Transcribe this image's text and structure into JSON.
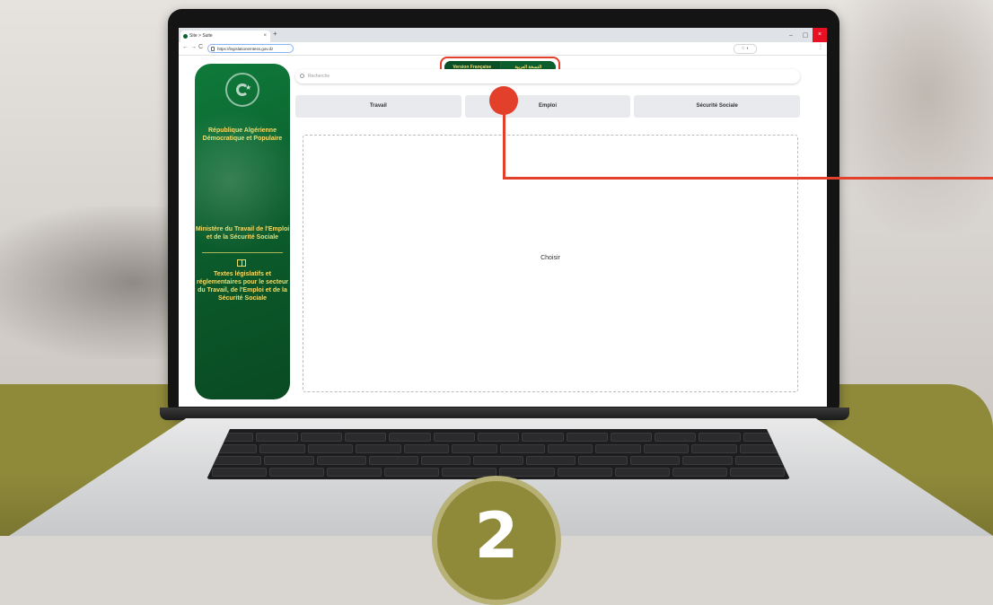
{
  "browser": {
    "tab_title": "Site > Suite",
    "tab_close": "×",
    "new_tab": "+",
    "url": "https://legislationemtess.gov.dz",
    "window_controls": [
      "–",
      "▢",
      "×"
    ],
    "nav": [
      "←",
      "→",
      "C"
    ]
  },
  "page": {
    "language": {
      "french": "Version Française",
      "arabic": "النسخة العربية"
    },
    "search_placeholder": "Recherche",
    "tabs": [
      "Travail",
      "Emploi",
      "Sécurité Sociale"
    ],
    "content_placeholder": "Choisir",
    "sidebar": {
      "country": "République Algérienne Démocratique et Populaire",
      "ministry": "Ministère du Travail de l'Emploi et de la Sécurité Sociale",
      "texts": "Textes législatifs et réglementaires pour le secteur du Travail, de l'Emploi et de la Sécurité Sociale"
    }
  },
  "step": {
    "number": "2"
  },
  "colors": {
    "brand_green": "#0b5e2d",
    "accent_gold": "#f2dd6b",
    "olive": "#8f8a3a",
    "callout_red": "#e2402b"
  }
}
